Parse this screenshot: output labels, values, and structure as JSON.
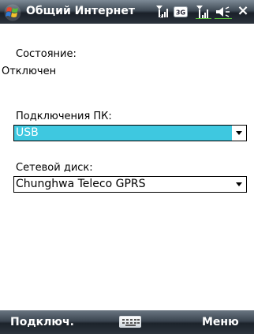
{
  "window": {
    "title": "Общий Интернет",
    "icons": [
      "windows-start-icon",
      "signal-roaming-icon",
      "3g-icon",
      "signal-icon",
      "volume-icon",
      "close-icon"
    ],
    "close_glyph": "×",
    "network_badge": "3G"
  },
  "status": {
    "label": "Состояние:",
    "value": "Отключен"
  },
  "pc_connection": {
    "label": "Подключения ПК:",
    "selected": "USB"
  },
  "network_drive": {
    "label": "Сетевой диск:",
    "selected": "Chunghwa Teleco GPRS"
  },
  "softkeys": {
    "left": "Подключ.",
    "right": "Меню"
  },
  "colors": {
    "selection": "#3ec8e0"
  }
}
